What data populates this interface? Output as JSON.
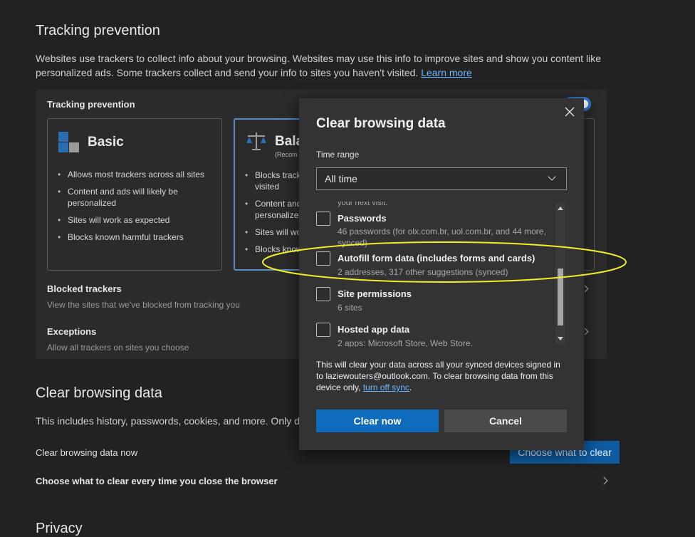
{
  "tracking": {
    "section_title": "Tracking prevention",
    "desc_line1": "Websites use trackers to collect info about your browsing. Websites may use this info to improve sites and show you content like",
    "desc_line2": "personalized ads. Some trackers collect and send your info to sites you haven't visited.",
    "learn_more": "Learn more",
    "card_title": "Tracking prevention",
    "basic": {
      "title": "Basic",
      "bullets": [
        "Allows most trackers across all sites",
        "Content and ads will likely be personalized",
        "Sites will work as expected",
        "Blocks known harmful trackers"
      ]
    },
    "balanced": {
      "title": "Bala",
      "subtitle": "(Recom",
      "bullets": [
        "Blocks tracke visited",
        "Content and personalized",
        "Sites will wo",
        "Blocks know"
      ]
    },
    "blocked_title": "Blocked trackers",
    "blocked_sub": "View the sites that we've blocked from tracking you",
    "exceptions_title": "Exceptions",
    "exceptions_sub": "Allow all trackers on sites you choose"
  },
  "clear_section": {
    "title": "Clear browsing data",
    "desc": "This includes history, passwords, cookies, and more. Only da",
    "now_label": "Clear browsing data now",
    "choose_button": "Choose what to clear",
    "every_time_label": "Choose what to clear every time you close the browser"
  },
  "privacy_title": "Privacy",
  "dialog": {
    "title": "Clear browsing data",
    "time_range_label": "Time range",
    "time_range_value": "All time",
    "partial_top": "your next visit.",
    "options": [
      {
        "title": "Passwords",
        "sub": "46 passwords (for olx.com.br, uol.com.br, and 44 more, synced)"
      },
      {
        "title": "Autofill form data (includes forms and cards)",
        "sub": "2 addresses, 317 other suggestions (synced)"
      },
      {
        "title": "Site permissions",
        "sub": "6 sites"
      },
      {
        "title": "Hosted app data",
        "sub": "2 apps: Microsoft Store, Web Store."
      }
    ],
    "note_part1": "This will clear your data across all your synced devices signed in to laziewouters@outlook.com. To clear browsing data from this device only,",
    "note_link": "turn off sync",
    "note_end": ".",
    "clear_now": "Clear now",
    "cancel": "Cancel"
  },
  "colors": {
    "background": "#222222",
    "dialog": "#333333",
    "primary_button": "#0f6cbd",
    "link": "#6cb6ff",
    "highlight_ellipse": "#f2ee2a"
  }
}
